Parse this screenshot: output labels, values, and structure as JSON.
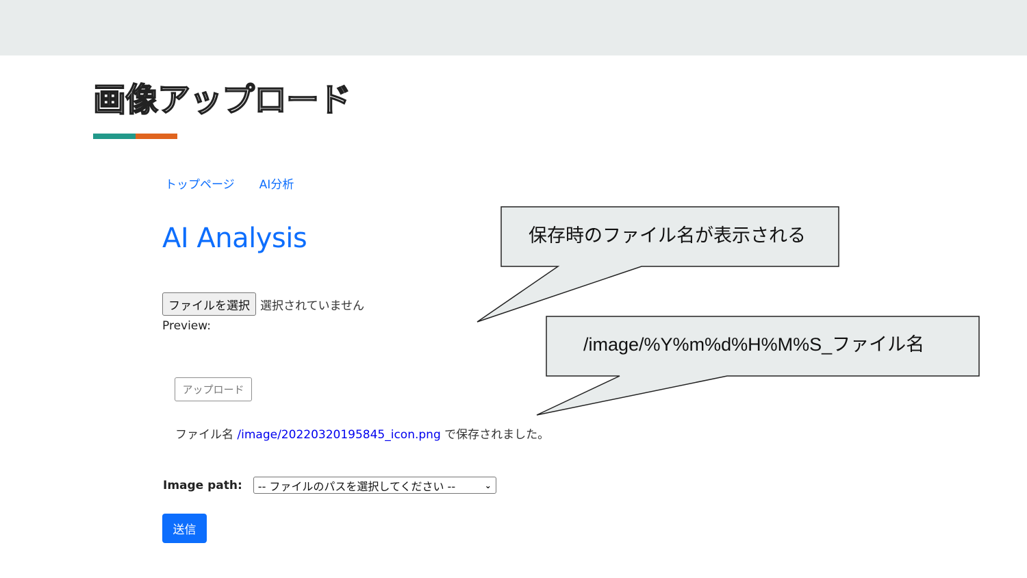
{
  "slide": {
    "title": "画像アップロード",
    "underline_colors": [
      "#22998a",
      "#e0641e"
    ]
  },
  "nav": {
    "items": [
      {
        "label": "トップページ"
      },
      {
        "label": "AI分析"
      }
    ]
  },
  "main": {
    "heading": "AI Analysis",
    "file_input": {
      "button_label": "ファイルを選択",
      "status": "選択されていません"
    },
    "preview_label": "Preview:",
    "upload_button": "アップロード",
    "saved_message": {
      "prefix": "ファイル名",
      "path": "/image/20220320195845_icon.png",
      "suffix": "で保存されました。"
    },
    "image_path": {
      "label": "Image path:",
      "selected": "-- ファイルのパスを選択してください --"
    },
    "submit_button": "送信"
  },
  "callouts": [
    {
      "text": "保存時のファイル名が表示される"
    },
    {
      "text": "/image/%Y%m%d%H%M%S_ファイル名"
    }
  ],
  "colors": {
    "accent_blue": "#0d6efd",
    "callout_fill": "#e8ecec"
  }
}
